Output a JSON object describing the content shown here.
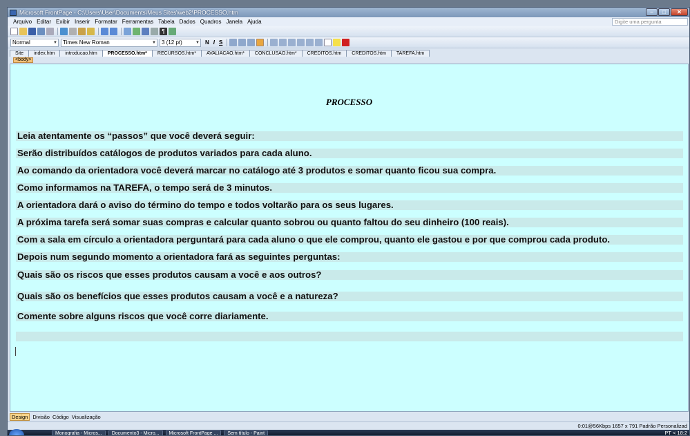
{
  "window": {
    "title": "Microsoft FrontPage - C:\\Users\\User\\Documents\\Meus Sites\\web2\\PROCESSO.htm"
  },
  "menu": [
    "Arquivo",
    "Editar",
    "Exibir",
    "Inserir",
    "Formatar",
    "Ferramentas",
    "Tabela",
    "Dados",
    "Quadros",
    "Janela",
    "Ajuda"
  ],
  "ask_placeholder": "Digite uma pergunta",
  "format": {
    "style": "Normal",
    "font": "Times New Roman",
    "size": "3 (12 pt)"
  },
  "tabs": [
    "Site",
    "index.htm",
    "introducao.htm",
    "PROCESSO.htm*",
    "RECURSOS.htm*",
    "AVALIACAO.htm*",
    "CONCLUSAO.htm*",
    "CREDITOS.htm",
    "CREDITOS.htm",
    "TAREFA.htm"
  ],
  "active_tab": 3,
  "tag": "<body>",
  "page": {
    "title": "PROCESSO",
    "lines": [
      "Leia atentamente os “passos” que você deverá seguir:",
      "Serão distribuídos catálogos de produtos variados para cada aluno.",
      "Ao comando da orientadora você deverá marcar no catálogo até 3 produtos e somar quanto ficou sua compra.",
      "Como informamos na TAREFA, o tempo será de 3 minutos.",
      "A orientadora dará o aviso do término do tempo e todos voltarão para os seus lugares.",
      "A próxima tarefa será somar suas compras e calcular quanto sobrou ou quanto faltou do seu dinheiro (100 reais).",
      "Com a sala em círculo a orientadora perguntará para cada aluno o que ele comprou, quanto ele gastou e por que comprou cada produto.",
      "Depois num segundo momento a orientadora fará as seguintes perguntas:",
      "Quais são os riscos que esses produtos causam a você e aos outros?",
      "Quais são os benefícios que esses produtos causam a você e a natureza?",
      "Comente sobre alguns riscos que você corre diariamente."
    ]
  },
  "views": [
    "Design",
    "Divisão",
    "Código",
    "Visualização"
  ],
  "status": "0:01@56Kbps  1657 x 791  Padrão  Personalizad",
  "taskbar": {
    "items": [
      "Monografia - Micros...",
      "Documento3 - Micro...",
      "Microsoft FrontPage ...",
      "Sem título - Paint"
    ],
    "tray": "PT  <  18:2"
  }
}
